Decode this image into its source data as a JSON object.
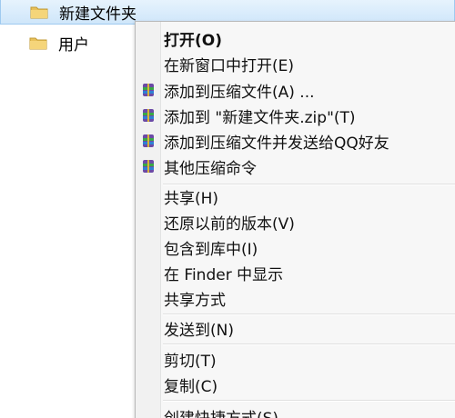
{
  "tree": {
    "selected_folder": "新建文件夹",
    "user_folder": "用户"
  },
  "menu": {
    "items": [
      {
        "label": "打开(O)",
        "bold": true
      },
      {
        "label": "在新窗口中打开(E)"
      },
      {
        "label": "添加到压缩文件(A) ...",
        "icon": "archive-icon"
      },
      {
        "label": "添加到 \"新建文件夹.zip\"(T)",
        "icon": "archive-icon"
      },
      {
        "label": "添加到压缩文件并发送给QQ好友",
        "icon": "archive-icon"
      },
      {
        "label": "其他压缩命令",
        "icon": "archive-icon"
      },
      {
        "label": "共享(H)"
      },
      {
        "label": "还原以前的版本(V)"
      },
      {
        "label": "包含到库中(I)"
      },
      {
        "label": "在 Finder 中显示"
      },
      {
        "label": "共享方式"
      },
      {
        "label": "发送到(N)"
      },
      {
        "label": "剪切(T)"
      },
      {
        "label": "复制(C)"
      },
      {
        "label": "创建快捷方式(S)"
      }
    ]
  },
  "colors": {
    "selection": "#cfe6fa",
    "menu_background": "#f7f7f7",
    "folder": "#e8c15b"
  }
}
